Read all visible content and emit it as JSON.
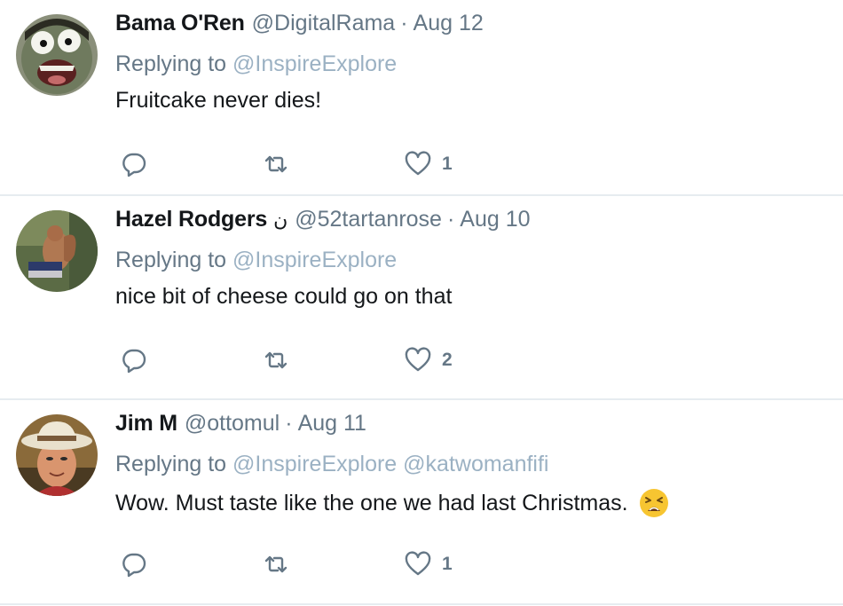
{
  "tweets": [
    {
      "name": "Bama O'Ren",
      "name_emoji": "",
      "handle": "@DigitalRama",
      "separator": "·",
      "date": "Aug 12",
      "replying_prefix": "Replying to",
      "replying_to": [
        "@InspireExplore"
      ],
      "text": "Fruitcake never dies!",
      "emoji": "",
      "likes": "1",
      "avatar_icon": "cartoon-face-icon"
    },
    {
      "name": "Hazel Rodgers",
      "name_emoji": "ن",
      "handle": "@52tartanrose",
      "separator": "·",
      "date": "Aug 10",
      "replying_prefix": "Replying to",
      "replying_to": [
        "@InspireExplore"
      ],
      "text": "nice bit of cheese could go on that",
      "emoji": "",
      "likes": "2",
      "avatar_icon": "squirrel-photo-icon"
    },
    {
      "name": "Jim M",
      "name_emoji": "",
      "handle": "@ottomul",
      "separator": "·",
      "date": "Aug 11",
      "replying_prefix": "Replying to",
      "replying_to": [
        "@InspireExplore",
        "@katwomanfifi"
      ],
      "text": "Wow.  Must taste like the one we had last Christmas.",
      "emoji": "tired-face-emoji",
      "likes": "1",
      "avatar_icon": "man-with-hat-icon"
    }
  ],
  "colors": {
    "primary_text": "#14171a",
    "secondary_text": "#657786",
    "mention": "#7a98b0",
    "divider": "#e6ecf0",
    "icon": "#657786"
  }
}
